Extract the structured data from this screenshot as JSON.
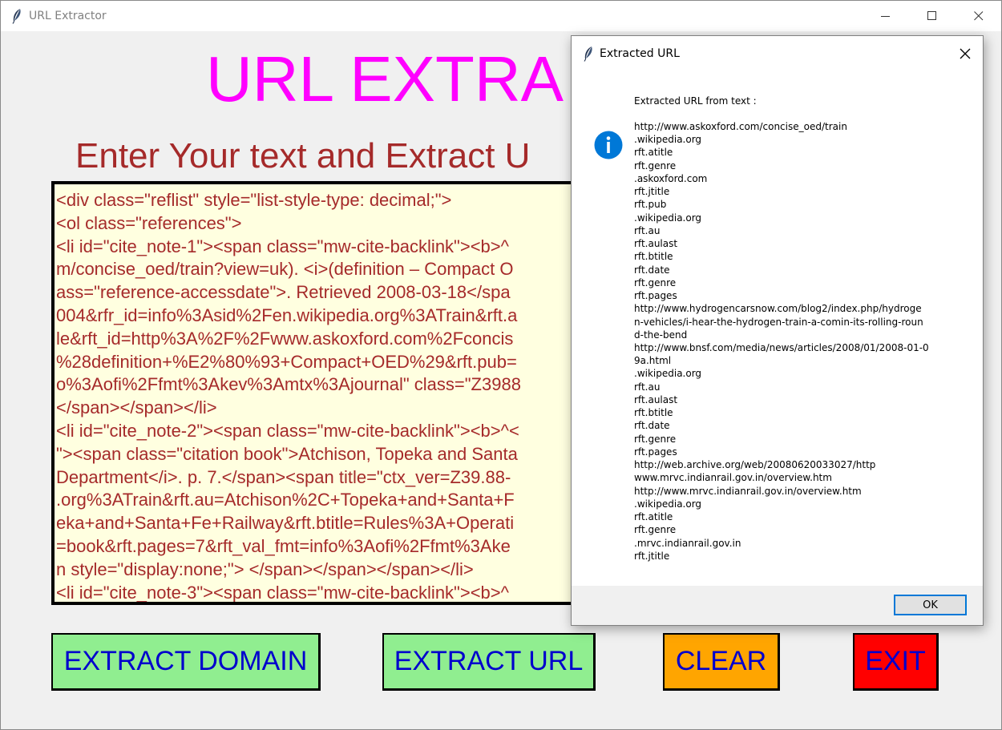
{
  "window": {
    "title": "URL Extractor"
  },
  "app": {
    "heading": "URL EXTRA",
    "subheading": "Enter Your text and Extract U",
    "text_lines": [
      "<div class=\"reflist\" style=\"list-style-type: decimal;\">",
      "<ol class=\"references\">",
      "<li id=\"cite_note-1\"><span class=\"mw-cite-backlink\"><b>^",
      "m/concise_oed/train?view=uk). <i>(definition – Compact O",
      "ass=\"reference-accessdate\">. Retrieved 2008-03-18</spa",
      "004&rfr_id=info%3Asid%2Fen.wikipedia.org%3ATrain&rft.a",
      "le&rft_id=http%3A%2F%2Fwww.askoxford.com%2Fconcis",
      "%28definition+%E2%80%93+Compact+OED%29&rft.pub=",
      "o%3Aofi%2Ffmt%3Akev%3Amtx%3Ajournal\" class=\"Z3988",
      "</span></span></li>",
      "<li id=\"cite_note-2\"><span class=\"mw-cite-backlink\"><b>^<",
      "\"><span class=\"citation book\">Atchison, Topeka and Santa",
      "Department</i>. p. 7.</span><span title=\"ctx_ver=Z39.88-",
      ".org%3ATrain&rft.au=Atchison%2C+Topeka+and+Santa+F",
      "eka+and+Santa+Fe+Railway&rft.btitle=Rules%3A+Operati",
      "=book&rft.pages=7&rft_val_fmt=info%3Aofi%2Ffmt%3Ake",
      "n style=\"display:none;\"> </span></span></span></li>",
      "<li id=\"cite_note-3\"><span class=\"mw-cite-backlink\"><b>^"
    ],
    "buttons": {
      "extract_domain": "EXTRACT DOMAIN",
      "extract_url": "EXTRACT URL",
      "clear": "CLEAR",
      "exit": "EXIT"
    }
  },
  "dialog": {
    "title": "Extracted URL",
    "heading": "Extracted URL from text :",
    "url_lines": [
      "http://www.askoxford.com/concise_oed/train",
      ".wikipedia.org",
      "rft.atitle",
      "rft.genre",
      ".askoxford.com",
      "rft.jtitle",
      "rft.pub",
      ".wikipedia.org",
      "rft.au",
      "rft.aulast",
      "rft.btitle",
      "rft.date",
      "rft.genre",
      "rft.pages",
      "http://www.hydrogencarsnow.com/blog2/index.php/hydroge",
      "n-vehicles/i-hear-the-hydrogen-train-a-comin-its-rolling-roun",
      "d-the-bend",
      "http://www.bnsf.com/media/news/articles/2008/01/2008-01-0",
      "9a.html",
      ".wikipedia.org",
      "rft.au",
      "rft.aulast",
      "rft.btitle",
      "rft.date",
      "rft.genre",
      "rft.pages",
      "http://web.archive.org/web/20080620033027/http",
      "www.mrvc.indianrail.gov.in/overview.htm",
      "http://www.mrvc.indianrail.gov.in/overview.htm",
      ".wikipedia.org",
      "rft.atitle",
      "rft.genre",
      ".mrvc.indianrail.gov.in",
      "rft.jtitle"
    ],
    "ok_label": "OK",
    "icon": "info-icon"
  },
  "colors": {
    "heading": "#ff00ff",
    "subheading": "#a52a2a",
    "text_area_bg": "#ffffe0",
    "text_color": "#a52a2a",
    "extract_button_bg": "#90ee90",
    "clear_button_bg": "#ffa500",
    "exit_button_bg": "#ff0000",
    "button_text": "#0000cd",
    "info_icon": "#0078d7"
  }
}
